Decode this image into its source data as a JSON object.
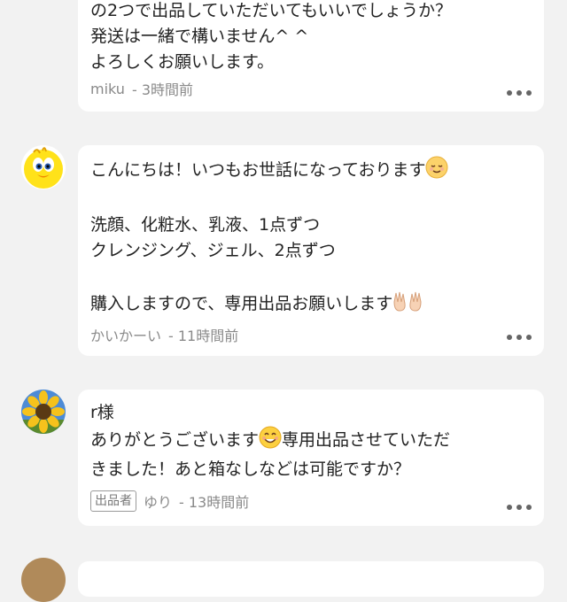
{
  "comments": [
    {
      "lines": [
        "の2つで出品していただいてもいいでしょうか？",
        "発送は一緒で構いません^ ^",
        "よろしくお願いします。"
      ],
      "author": "miku",
      "time": "- 3時間前",
      "avatar": "none"
    },
    {
      "line1": "こんにちは！いつもお世話になっております",
      "line1_emoji": "relieved-face",
      "line2": "",
      "line3": "洗顔、化粧水、乳液、1点ずつ",
      "line4": "クレンジング、ジェル、2点ずつ",
      "line5": "",
      "line6": "購入しますので、専用出品お願いします",
      "line6_emoji": "palms-up-hands",
      "author": "かいかーい",
      "time": "- 11時間前",
      "avatar": "yellow-bird"
    },
    {
      "line1": "r様",
      "line2a": "ありがとうございます",
      "line2_emoji": "smiling-face",
      "line2b": "専用出品させていただ",
      "line3": "きました！あと箱なしなどは可能ですか？",
      "badge": "出品者",
      "author": "ゆり",
      "time": "- 13時間前",
      "avatar": "sunflower"
    }
  ],
  "colors": {
    "background": "#f2f2f2",
    "bubble": "#ffffff",
    "meta_text": "#8a8a8a"
  }
}
